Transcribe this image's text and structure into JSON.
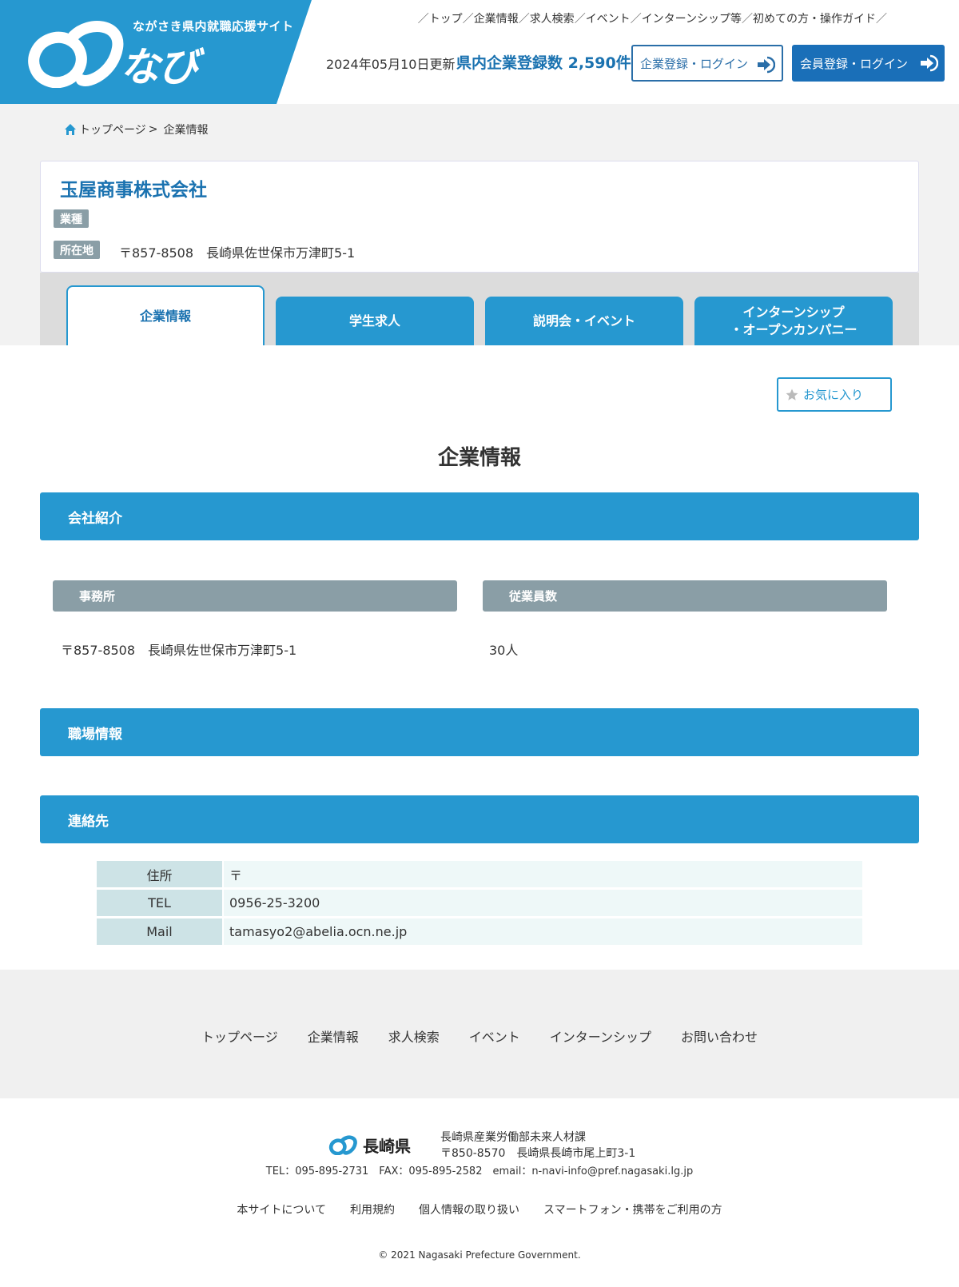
{
  "header": {
    "site_tagline": "ながさき県内就職応援サイト",
    "logo_text": "なび",
    "nav": [
      "トップ",
      "企業情報",
      "求人検索",
      "イベント",
      "インターンシップ等",
      "初めての方・操作ガイド"
    ],
    "nav_sep": "／",
    "updated": "2024年05月10日更新",
    "registered_count": "県内企業登録数 2,590件",
    "corp_login": "企業登録・ログイン",
    "member_login": "会員登録・ログイン",
    "accent_color": "#2698d0"
  },
  "breadcrumb": {
    "home": "トップページ",
    "sep": ">",
    "current": "企業情報"
  },
  "company": {
    "name": "玉屋商事株式会社",
    "industry_label": "業種",
    "location_label": "所在地",
    "address": "〒857-8508　長崎県佐世保市万津町5-1"
  },
  "tabs": [
    {
      "label": "企業情報",
      "active": true
    },
    {
      "label": "学生求人",
      "active": false
    },
    {
      "label": "説明会・イベント",
      "active": false
    },
    {
      "label_line1": "インターンシップ",
      "label_line2": "・オープンカンパニー",
      "active": false
    }
  ],
  "favorite_label": "お気に入り",
  "page_heading": "企業情報",
  "sections": {
    "intro": "会社紹介",
    "workplace": "職場情報",
    "contact": "連絡先"
  },
  "intro": {
    "office_label": "事務所",
    "office_value": "〒857-8508　長崎県佐世保市万津町5-1",
    "employees_label": "従業員数",
    "employees_value": "30人"
  },
  "contact": [
    {
      "key": "住所",
      "value": "〒"
    },
    {
      "key": "TEL",
      "value": "0956-25-3200"
    },
    {
      "key": "Mail",
      "value": "tamasyo2@abelia.ocn.ne.jp"
    }
  ],
  "footer": {
    "nav": [
      "トップページ",
      "企業情報",
      "求人検索",
      "イベント",
      "インターンシップ",
      "お問い合わせ"
    ],
    "pref": "長崎県",
    "dept": "長崎県産業労働部未来人材課",
    "address": "〒850-8570　長崎県長崎市尾上町3-1",
    "contact": "TEL：095-895-2731　FAX：095-895-2582　email：n-navi-info@pref.nagasaki.lg.jp",
    "links": [
      "本サイトについて",
      "利用規約",
      "個人情報の取り扱い",
      "スマートフォン・携帯をご利用の方"
    ],
    "copyright": "© 2021 Nagasaki Prefecture Government."
  }
}
